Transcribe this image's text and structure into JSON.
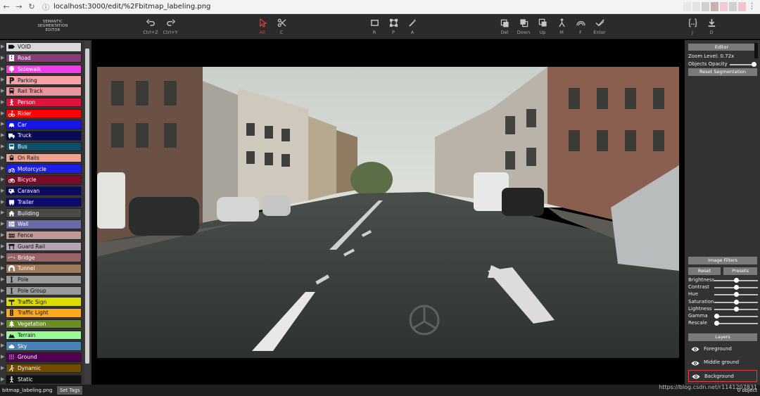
{
  "browser": {
    "url": "localhost:3000/edit/%2Fbitmap_labeling.png",
    "ext_colors": [
      "#e8e8e8",
      "#e3e3e3",
      "#cfcfcf",
      "#c9b1b1",
      "#f2c9d4",
      "#d0d0d0",
      "#f5c1d0"
    ]
  },
  "app": {
    "logo_lines": [
      "SEMANTIC",
      "SEGMENTATION",
      "EDITOR"
    ]
  },
  "toolbar": [
    {
      "name": "undo",
      "label": "Ctrl+Z",
      "icon": "undo-icon",
      "active": false
    },
    {
      "name": "redo",
      "label": "Ctrl+Y",
      "icon": "redo-icon",
      "active": false
    },
    {
      "name": "select",
      "label": "Alt",
      "icon": "cursor-icon",
      "active": true
    },
    {
      "name": "cut",
      "label": "C",
      "icon": "scissors-icon",
      "active": false
    },
    {
      "name": "rectangle",
      "label": "R",
      "icon": "rectangle-icon",
      "active": false
    },
    {
      "name": "polygon",
      "label": "P",
      "icon": "polygon-icon",
      "active": false
    },
    {
      "name": "magic-wand",
      "label": "A",
      "icon": "magic-wand-icon",
      "active": false
    },
    {
      "name": "delete",
      "label": "Del",
      "icon": "delete-icon",
      "active": false
    },
    {
      "name": "down",
      "label": "Down",
      "icon": "send-backward-icon",
      "active": false
    },
    {
      "name": "up",
      "label": "Up",
      "icon": "bring-forward-icon",
      "active": false
    },
    {
      "name": "merge",
      "label": "M",
      "icon": "merge-icon",
      "active": false
    },
    {
      "name": "fill",
      "label": "F",
      "icon": "rainbow-icon",
      "active": false
    },
    {
      "name": "enter",
      "label": "Enter",
      "icon": "check-icon",
      "active": false
    },
    {
      "name": "json",
      "label": "J",
      "icon": "json-icon",
      "active": false
    },
    {
      "name": "download",
      "label": "D",
      "icon": "download-icon",
      "active": false
    }
  ],
  "categories": [
    {
      "name": "VOID",
      "color": "#d9d9d9",
      "text": "#111",
      "icon": "tag-icon"
    },
    {
      "name": "Road",
      "color": "#8b3b78",
      "text": "#fff",
      "icon": "road-icon"
    },
    {
      "name": "Sidewalk",
      "color": "#f23be8",
      "text": "#fff",
      "icon": "sidewalk-icon"
    },
    {
      "name": "Parking",
      "color": "#f5a3a8",
      "text": "#111",
      "icon": "parking-icon"
    },
    {
      "name": "Rail Track",
      "color": "#e8969e",
      "text": "#111",
      "icon": "train-icon"
    },
    {
      "name": "Person",
      "color": "#dc143c",
      "text": "#fff",
      "icon": "person-icon"
    },
    {
      "name": "Rider",
      "color": "#ff0000",
      "text": "#fff",
      "icon": "rider-icon"
    },
    {
      "name": "Car",
      "color": "#1515e6",
      "text": "#fff",
      "icon": "car-icon"
    },
    {
      "name": "Truck",
      "color": "#0a0a55",
      "text": "#fff",
      "icon": "truck-icon"
    },
    {
      "name": "Bus",
      "color": "#0b4f6b",
      "text": "#fff",
      "icon": "bus-icon"
    },
    {
      "name": "On Rails",
      "color": "#f0a08c",
      "text": "#111",
      "icon": "tram-icon"
    },
    {
      "name": "Motorcycle",
      "color": "#1e1ee6",
      "text": "#fff",
      "icon": "motorcycle-icon"
    },
    {
      "name": "Bicycle",
      "color": "#7a0a2a",
      "text": "#fff",
      "icon": "bicycle-icon"
    },
    {
      "name": "Caravan",
      "color": "#0b0b5a",
      "text": "#fff",
      "icon": "caravan-icon"
    },
    {
      "name": "Trailer",
      "color": "#0b0b6e",
      "text": "#fff",
      "icon": "trailer-icon"
    },
    {
      "name": "Building",
      "color": "#4a4a4a",
      "text": "#fff",
      "icon": "building-icon"
    },
    {
      "name": "Wall",
      "color": "#6a6aa6",
      "text": "#fff",
      "icon": "wall-icon"
    },
    {
      "name": "Fence",
      "color": "#c09898",
      "text": "#111",
      "icon": "fence-icon"
    },
    {
      "name": "Guard Rail",
      "color": "#b4a5b4",
      "text": "#111",
      "icon": "guard-rail-icon"
    },
    {
      "name": "Bridge",
      "color": "#9a6464",
      "text": "#fff",
      "icon": "bridge-icon"
    },
    {
      "name": "Tunnel",
      "color": "#a07a5a",
      "text": "#fff",
      "icon": "tunnel-icon"
    },
    {
      "name": "Pole",
      "color": "#9a9a9a",
      "text": "#111",
      "icon": "pole-icon"
    },
    {
      "name": "Pole Group",
      "color": "#9a9a9a",
      "text": "#111",
      "icon": "pole-group-icon"
    },
    {
      "name": "Traffic Sign",
      "color": "#dcdc00",
      "text": "#111",
      "icon": "traffic-sign-icon"
    },
    {
      "name": "Traffic Light",
      "color": "#faaa1e",
      "text": "#111",
      "icon": "traffic-light-icon"
    },
    {
      "name": "Vegetation",
      "color": "#6b8e23",
      "text": "#fff",
      "icon": "tree-icon"
    },
    {
      "name": "Terrain",
      "color": "#98fb98",
      "text": "#111",
      "icon": "terrain-icon"
    },
    {
      "name": "Sky",
      "color": "#4682b4",
      "text": "#fff",
      "icon": "cloud-icon"
    },
    {
      "name": "Ground",
      "color": "#510051",
      "text": "#fff",
      "icon": "ground-icon"
    },
    {
      "name": "Dynamic",
      "color": "#6f4a00",
      "text": "#fff",
      "icon": "dynamic-icon"
    },
    {
      "name": "Static",
      "color": "#111111",
      "text": "#fff",
      "icon": "static-icon"
    }
  ],
  "right": {
    "editor_header": "Editor",
    "zoom_label": "Zoom Level: 0.72x",
    "opacity_label": "Objects Opacity",
    "opacity_value": 0.92,
    "reset_segmentation": "Reset Segmentation",
    "filters_header": "Image Filters",
    "reset": "Reset",
    "presets": "Presets",
    "filters": [
      {
        "name": "Brightness",
        "value": 0.5
      },
      {
        "name": "Contrast",
        "value": 0.5
      },
      {
        "name": "Hue",
        "value": 0.5
      },
      {
        "name": "Saturation",
        "value": 0.5
      },
      {
        "name": "Lightness",
        "value": 0.5
      },
      {
        "name": "Gamma",
        "value": 0.05
      },
      {
        "name": "Rescale",
        "value": 0.05
      }
    ],
    "layers_header": "Layers",
    "layers": [
      {
        "name": "Foreground",
        "selected": false
      },
      {
        "name": "Middle ground",
        "selected": false
      },
      {
        "name": "Background",
        "selected": true
      }
    ]
  },
  "status": {
    "file": "bitmap_labeling.png",
    "set_tags": "Set Tags",
    "count": "0 object",
    "watermark": "https://blog.csdn.net/r1141207831"
  }
}
